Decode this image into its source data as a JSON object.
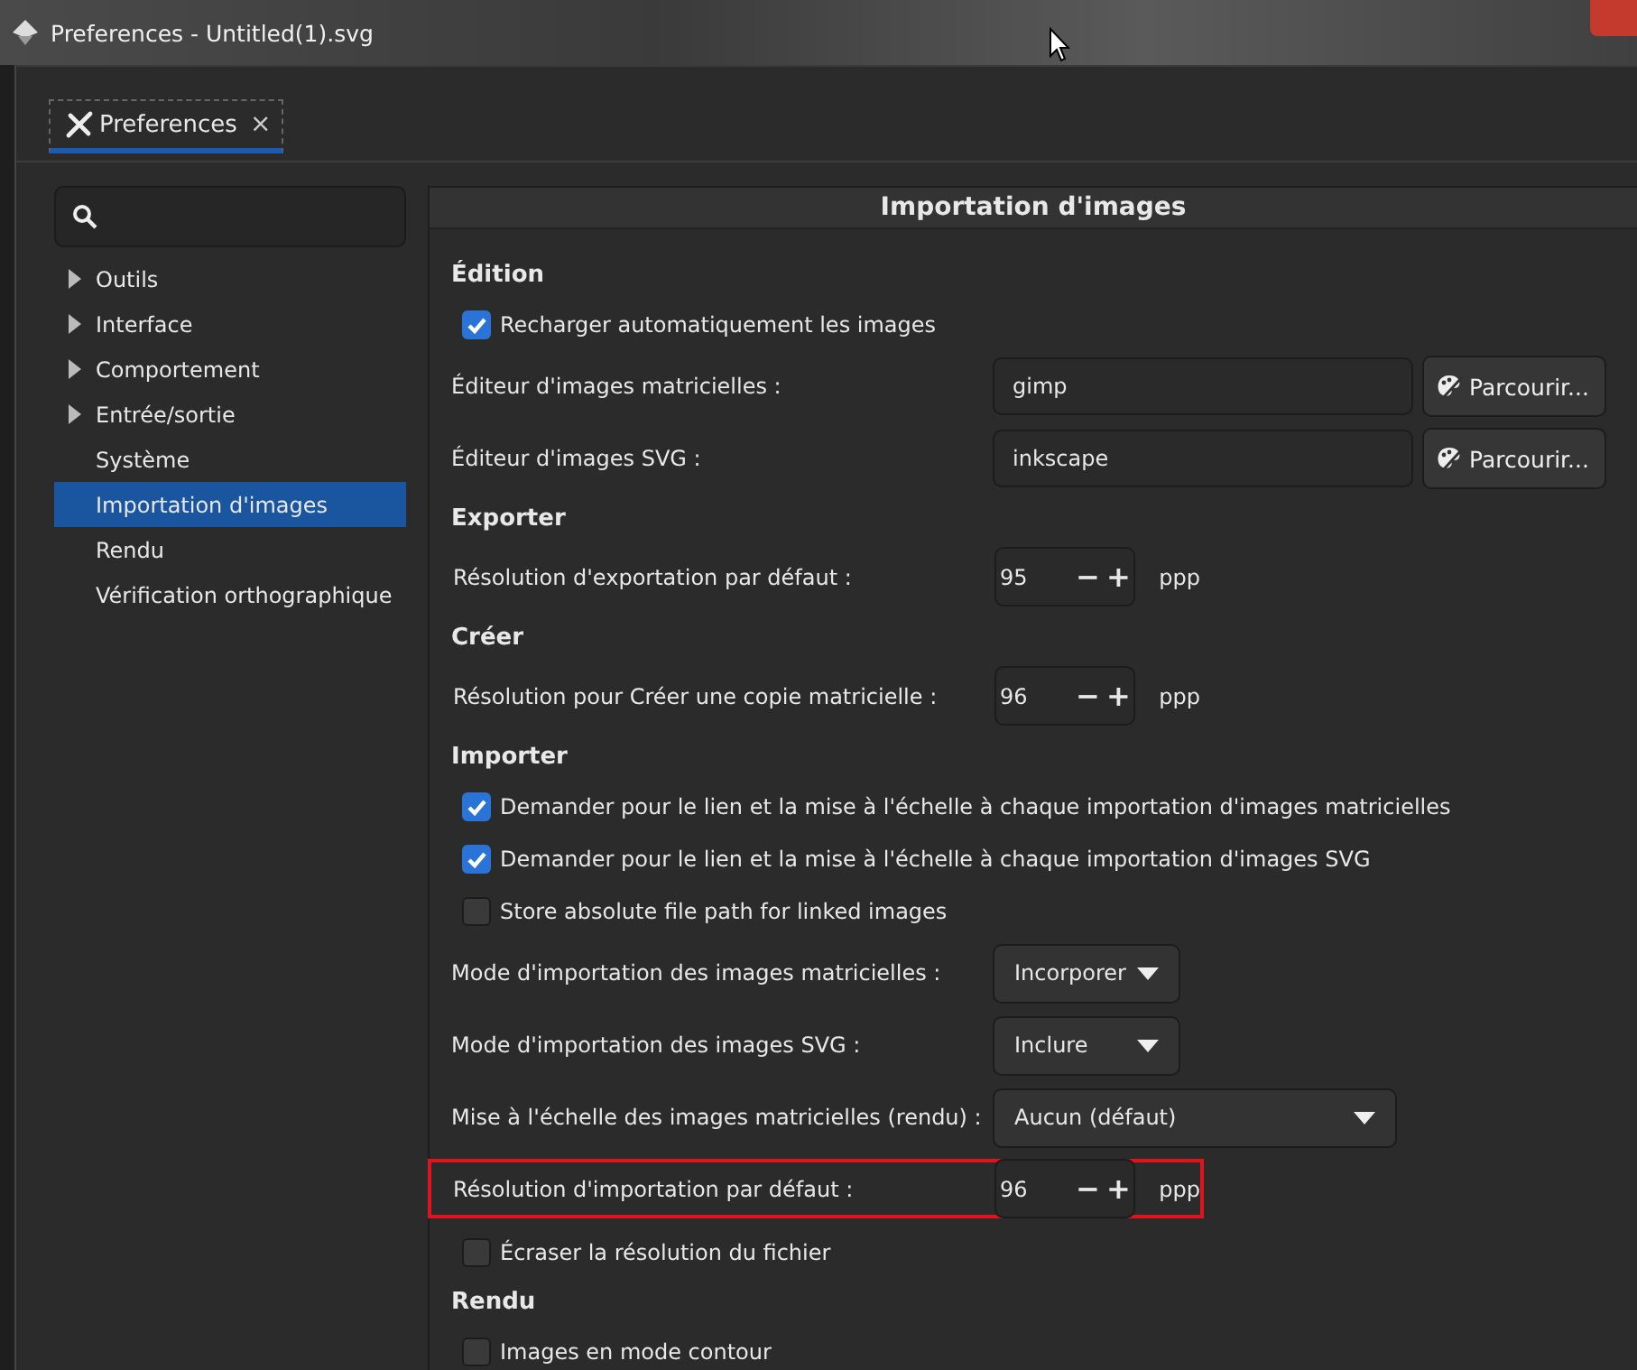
{
  "window": {
    "title": "Preferences - Untitled(1).svg"
  },
  "tabs": [
    {
      "label": "Preferences",
      "selected": true,
      "close": "×"
    }
  ],
  "sidebar": {
    "items": [
      {
        "label": "Outils",
        "expandable": true,
        "selected": false
      },
      {
        "label": "Interface",
        "expandable": true,
        "selected": false
      },
      {
        "label": "Comportement",
        "expandable": true,
        "selected": false
      },
      {
        "label": "Entrée/sortie",
        "expandable": true,
        "selected": false
      },
      {
        "label": "Système",
        "expandable": false,
        "selected": false
      },
      {
        "label": "Importation d'images",
        "expandable": false,
        "selected": true
      },
      {
        "label": "Rendu",
        "expandable": false,
        "selected": false
      },
      {
        "label": "Vérification orthographique",
        "expandable": false,
        "selected": false
      }
    ]
  },
  "panel": {
    "title": "Importation d'images",
    "rows": [
      {
        "kind": "heading",
        "label": "Édition"
      },
      {
        "kind": "checkbox",
        "label": "Recharger automatiquement les images",
        "checked": true
      },
      {
        "kind": "path",
        "label": "Éditeur d'images matricielles :",
        "value": "gimp",
        "button": "Parcourir..."
      },
      {
        "kind": "path",
        "label": "Éditeur d'images SVG :",
        "value": "inkscape",
        "button": "Parcourir..."
      },
      {
        "kind": "heading",
        "label": "Exporter"
      },
      {
        "kind": "spin",
        "label": "Résolution d'exportation par défaut :",
        "value": "95",
        "minus": "−",
        "plus": "+",
        "unit": "ppp",
        "highlighted": false
      },
      {
        "kind": "heading",
        "label": "Créer"
      },
      {
        "kind": "spin",
        "label": "Résolution pour Créer une copie matricielle :",
        "value": "96",
        "minus": "−",
        "plus": "+",
        "unit": "ppp",
        "highlighted": false
      },
      {
        "kind": "heading",
        "label": "Importer"
      },
      {
        "kind": "checkbox",
        "label": "Demander pour le lien et la mise à l'échelle à chaque importation d'images matricielles",
        "checked": true
      },
      {
        "kind": "checkbox",
        "label": "Demander pour le lien et la mise à l'échelle à chaque importation d'images SVG",
        "checked": true
      },
      {
        "kind": "checkbox",
        "label": "Store absolute file path for linked images",
        "checked": false
      },
      {
        "kind": "combo",
        "label": "Mode d'importation des images matricielles :",
        "value": "Incorporer",
        "wide": false
      },
      {
        "kind": "combo",
        "label": "Mode d'importation des images SVG :",
        "value": "Inclure",
        "wide": false
      },
      {
        "kind": "combo",
        "label": "Mise à l'échelle des images matricielles (rendu) :",
        "value": "Aucun (défaut)",
        "wide": true
      },
      {
        "kind": "spin",
        "label": "Résolution d'importation par défaut :",
        "value": "96",
        "minus": "−",
        "plus": "+",
        "unit": "ppp",
        "highlighted": true
      },
      {
        "kind": "checkbox",
        "label": "Écraser la résolution du fichier",
        "checked": false
      },
      {
        "kind": "heading",
        "label": "Rendu"
      },
      {
        "kind": "checkbox",
        "label": "Images en mode contour",
        "checked": false
      }
    ]
  }
}
